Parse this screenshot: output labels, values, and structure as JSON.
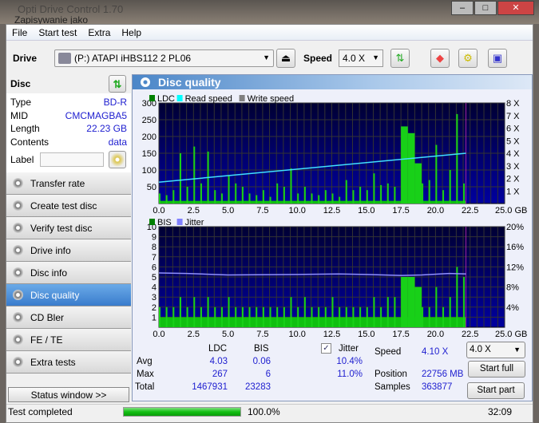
{
  "window": {
    "title": "Opti Drive Control 1.70",
    "subtitle": "Zapisywanie jako"
  },
  "menu": [
    "File",
    "Start test",
    "Extra",
    "Help"
  ],
  "toolbar": {
    "drive_label": "Drive",
    "drive_value": "(P:)   ATAPI iHBS112   2 PL06",
    "speed_label": "Speed",
    "speed_value": "4.0 X"
  },
  "disc": {
    "header": "Disc",
    "rows": [
      {
        "k": "Type",
        "v": "BD-R"
      },
      {
        "k": "MID",
        "v": "CMCMAGBA5"
      },
      {
        "k": "Length",
        "v": "22.23 GB"
      },
      {
        "k": "Contents",
        "v": "data"
      }
    ],
    "label_key": "Label",
    "label_value": ""
  },
  "nav": [
    "Transfer rate",
    "Create test disc",
    "Verify test disc",
    "Drive info",
    "Disc info",
    "Disc quality",
    "CD Bler",
    "FE / TE",
    "Extra tests"
  ],
  "nav_active": "Disc quality",
  "status_window": "Status window >>",
  "panel_title": "Disc quality",
  "chart_data": [
    {
      "type": "bar",
      "legend": [
        "LDC",
        "Read speed",
        "Write speed"
      ],
      "legend_colors": [
        "#008000",
        "#00ffff",
        "#808080"
      ],
      "x_ticks": [
        "0.0",
        "2.5",
        "5.0",
        "7.5",
        "10.0",
        "12.5",
        "15.0",
        "17.5",
        "20.0",
        "22.5",
        "25.0 GB"
      ],
      "xlim": [
        0,
        25
      ],
      "y_ticks": [
        "50",
        "100",
        "150",
        "200",
        "250",
        "300"
      ],
      "ylim": [
        0,
        300
      ],
      "y2_ticks": [
        "1 X",
        "2 X",
        "3 X",
        "4 X",
        "5 X",
        "6 X",
        "7 X",
        "8 X"
      ],
      "y2lim": [
        0,
        8
      ],
      "x": [
        0,
        0.5,
        1,
        1.5,
        2,
        2.5,
        3,
        3.5,
        4,
        4.5,
        5,
        5.5,
        6,
        6.5,
        7,
        7.5,
        8,
        8.5,
        9,
        9.5,
        10,
        10.5,
        11,
        11.5,
        12,
        12.5,
        13,
        13.5,
        14,
        14.5,
        15,
        15.5,
        16,
        16.5,
        17,
        17.5,
        18,
        18.5,
        19,
        19.5,
        20,
        20.5,
        21,
        21.5,
        22
      ],
      "ldc": [
        30,
        25,
        40,
        150,
        50,
        170,
        60,
        155,
        40,
        30,
        85,
        60,
        50,
        30,
        25,
        40,
        20,
        60,
        50,
        105,
        30,
        50,
        30,
        25,
        40,
        30,
        20,
        70,
        40,
        50,
        40,
        90,
        55,
        60,
        50,
        230,
        210,
        120,
        60,
        70,
        175,
        40,
        100,
        267,
        60
      ],
      "read_speed": {
        "x": [
          0,
          22.2
        ],
        "y": [
          1.7,
          4.0
        ]
      }
    },
    {
      "type": "bar",
      "legend": [
        "BIS",
        "Jitter"
      ],
      "legend_colors": [
        "#008000",
        "#8080ff"
      ],
      "x_ticks": [
        "0.0",
        "2.5",
        "5.0",
        "7.5",
        "10.0",
        "12.5",
        "15.0",
        "17.5",
        "20.0",
        "22.5",
        "25.0 GB"
      ],
      "xlim": [
        0,
        25
      ],
      "y_ticks": [
        "1",
        "2",
        "3",
        "4",
        "5",
        "6",
        "7",
        "8",
        "9",
        "10"
      ],
      "ylim": [
        0,
        10
      ],
      "y2_ticks": [
        "4%",
        "8%",
        "12%",
        "16%",
        "20%"
      ],
      "y2lim": [
        0,
        20
      ],
      "x": [
        0,
        0.5,
        1,
        1.5,
        2,
        2.5,
        3,
        3.5,
        4,
        4.5,
        5,
        5.5,
        6,
        6.5,
        7,
        7.5,
        8,
        8.5,
        9,
        9.5,
        10,
        10.5,
        11,
        11.5,
        12,
        12.5,
        13,
        13.5,
        14,
        14.5,
        15,
        15.5,
        16,
        16.5,
        17,
        17.5,
        18,
        18.5,
        19,
        19.5,
        20,
        20.5,
        21,
        21.5,
        22
      ],
      "bis": [
        2,
        2,
        2,
        3,
        2,
        3,
        2,
        3,
        2,
        2,
        3,
        2,
        2,
        2,
        2,
        2,
        2,
        2,
        2,
        3,
        2,
        3,
        2,
        2,
        2,
        3,
        2,
        2,
        2,
        2,
        2,
        3,
        2,
        3,
        3,
        5,
        5,
        4,
        2,
        2,
        4,
        2,
        3,
        6,
        5
      ],
      "jitter": {
        "x": [
          0,
          2,
          5,
          10,
          13,
          15,
          17.5,
          19,
          21,
          22.2
        ],
        "y": [
          10.8,
          10.7,
          10.4,
          10.5,
          10.6,
          10.5,
          10.3,
          10.4,
          10.7,
          10.6
        ]
      }
    }
  ],
  "stats": {
    "col_ldc": "LDC",
    "col_bis": "BIS",
    "jitter_label": "Jitter",
    "jitter_checked": true,
    "avg_label": "Avg",
    "max_label": "Max",
    "total_label": "Total",
    "avg_ldc": "4.03",
    "avg_bis": "0.06",
    "avg_jitter": "10.4%",
    "max_ldc": "267",
    "max_bis": "6",
    "max_jitter": "11.0%",
    "total_ldc": "1467931",
    "total_bis": "23283",
    "speed_label": "Speed",
    "speed_value": "4.10 X",
    "position_label": "Position",
    "position_value": "22756 MB",
    "samples_label": "Samples",
    "samples_value": "363877",
    "speed_select": "4.0 X",
    "start_full": "Start full",
    "start_part": "Start part"
  },
  "status": {
    "text": "Test completed",
    "progress": 100,
    "progress_text": "100.0%",
    "time": "32:09"
  }
}
